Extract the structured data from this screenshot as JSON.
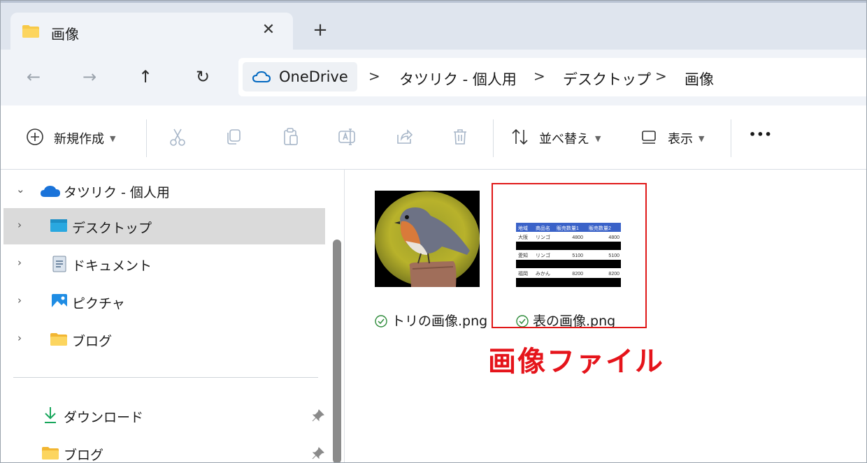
{
  "tab": {
    "title": "画像",
    "close": "✕",
    "new_tab": "+"
  },
  "nav": {
    "back": "←",
    "forward": "→",
    "up": "↑",
    "refresh": "↻"
  },
  "breadcrumb": {
    "root": "OneDrive",
    "separator": ">",
    "items": [
      "タツリク - 個人用",
      "デスクトップ",
      "画像"
    ]
  },
  "toolbar": {
    "new_label": "新規作成",
    "sort_label": "並べ替え",
    "view_label": "表示",
    "more": "•••"
  },
  "sidebar": {
    "root": "タツリク - 個人用",
    "items": [
      "デスクトップ",
      "ドキュメント",
      "ピクチャ",
      "ブログ"
    ],
    "quick": [
      "ダウンロード",
      "ブログ"
    ]
  },
  "files": [
    {
      "name": "トリの画像.png"
    },
    {
      "name": "表の画像.png"
    }
  ],
  "thumbnail_table": {
    "headers": [
      "地域",
      "商品名",
      "販売数量1",
      "販売数量2"
    ],
    "rows": [
      [
        "大阪",
        "リンゴ",
        "4800",
        "4800"
      ],
      [
        "愛知",
        "リンゴ",
        "5100",
        "5100"
      ],
      [
        "福岡",
        "みかん",
        "8200",
        "8200"
      ]
    ]
  },
  "annotation": "画像ファイル",
  "colors": {
    "accent": "#0067c0",
    "annotation": "#e5141b",
    "sync_ok": "#2e8b3a",
    "folder": "#f7c948"
  }
}
